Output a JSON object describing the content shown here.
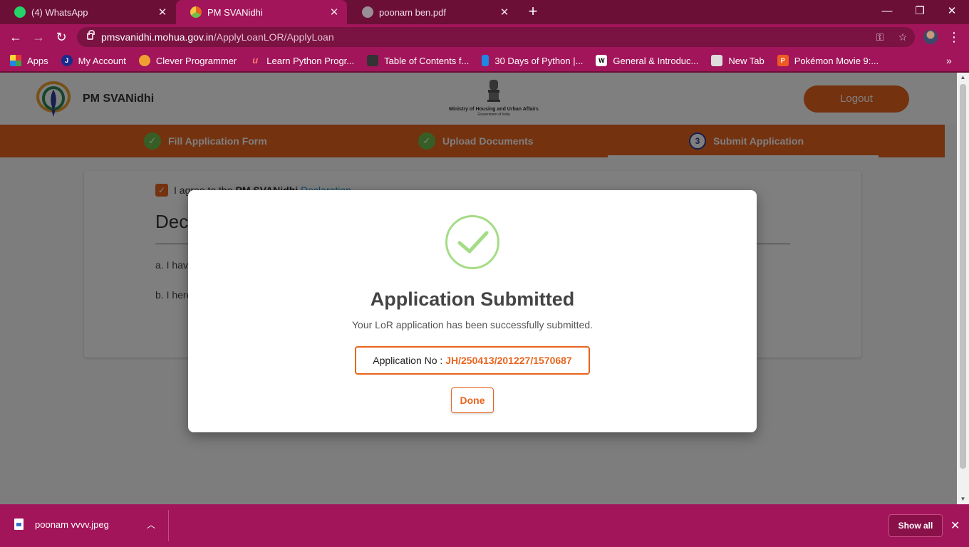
{
  "browser": {
    "tabs": [
      {
        "label": "(4) WhatsApp",
        "favicon": "whatsapp-icon",
        "active": false
      },
      {
        "label": "PM SVANidhi",
        "favicon": "svanidhi-icon",
        "active": true
      },
      {
        "label": "poonam ben.pdf",
        "favicon": "globe-icon",
        "active": false
      }
    ],
    "url_host": "pmsvanidhi.mohua.gov.in",
    "url_path": "/ApplyLoanLOR/ApplyLoan",
    "bookmarks": [
      {
        "label": "Apps",
        "icon": "apps-grid-icon"
      },
      {
        "label": "My Account",
        "icon": "jio-icon"
      },
      {
        "label": "Clever Programmer",
        "icon": "clever-programmer-icon"
      },
      {
        "label": "Learn Python Progr...",
        "icon": "learn-python-icon"
      },
      {
        "label": "Table of Contents f...",
        "icon": "table-of-contents-icon"
      },
      {
        "label": "30 Days of Python |...",
        "icon": "thirty-days-icon"
      },
      {
        "label": "General & Introduc...",
        "icon": "w-icon"
      },
      {
        "label": "New Tab",
        "icon": "new-tab-icon"
      },
      {
        "label": "Pokémon Movie 9:...",
        "icon": "pokemon-icon"
      }
    ]
  },
  "site": {
    "title": "PM SVANidhi",
    "ministry": "Ministry of Housing and Urban Affairs",
    "government": "Government of India",
    "logout": "Logout"
  },
  "steps": [
    {
      "label": "Fill Application Form",
      "status": "done"
    },
    {
      "label": "Upload Documents",
      "status": "done"
    },
    {
      "label": "Submit Application",
      "status": "current",
      "number": "3"
    }
  ],
  "declaration": {
    "agree_prefix": "I agree to the",
    "agree_bold": "PM SVANidhi",
    "agree_link": "Declaration",
    "title_partial": "Decl",
    "line_a": "a. I have",
    "line_b": "b. I here"
  },
  "modal": {
    "title": "Application Submitted",
    "message": "Your LoR application has been successfully submitted.",
    "appno_label": "Application No :",
    "appno_value": "JH/250413/201227/1570687",
    "done_label": "Done"
  },
  "downloads": {
    "file": "poonam vvvv.jpeg",
    "show_all": "Show all"
  },
  "colors": {
    "chrome": "#a2155a",
    "accent": "#e8641e",
    "success": "#a5dc86"
  }
}
